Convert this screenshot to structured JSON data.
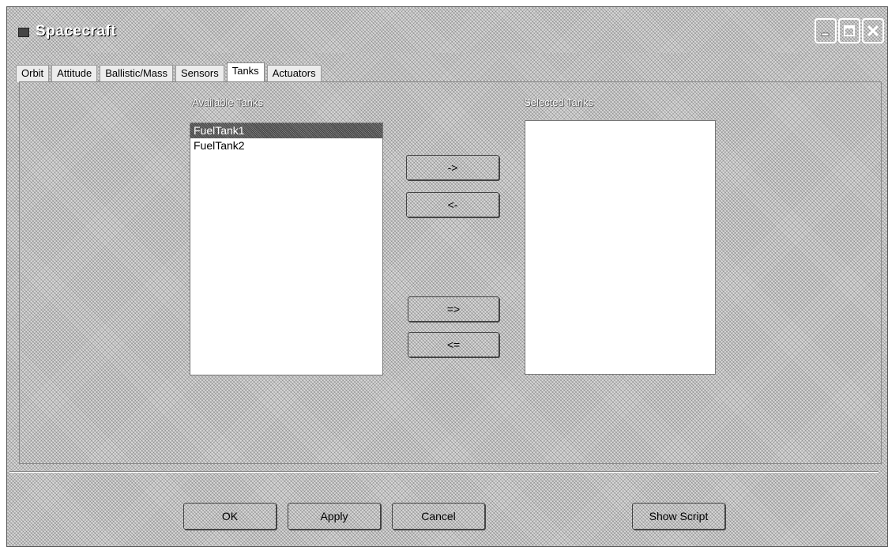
{
  "window": {
    "title": "Spacecraft"
  },
  "tabs": [
    {
      "label": "Orbit"
    },
    {
      "label": "Attitude"
    },
    {
      "label": "Ballistic/Mass"
    },
    {
      "label": "Sensors"
    },
    {
      "label": "Tanks",
      "active": true
    },
    {
      "label": "Actuators"
    }
  ],
  "tanks": {
    "available_label": "Available Tanks",
    "selected_label": "Selected Tanks",
    "available": [
      {
        "label": "FuelTank1",
        "selected": true
      },
      {
        "label": "FuelTank2",
        "selected": false
      }
    ],
    "selected": []
  },
  "move_buttons": {
    "add": "->",
    "remove": "<-",
    "add_all": "=>",
    "remove_all": "<="
  },
  "footer": {
    "ok": "OK",
    "apply": "Apply",
    "cancel": "Cancel",
    "show_script": "Show Script"
  },
  "icons": {
    "minimize": "minimize-icon",
    "maximize": "maximize-icon",
    "close": "close-icon"
  }
}
